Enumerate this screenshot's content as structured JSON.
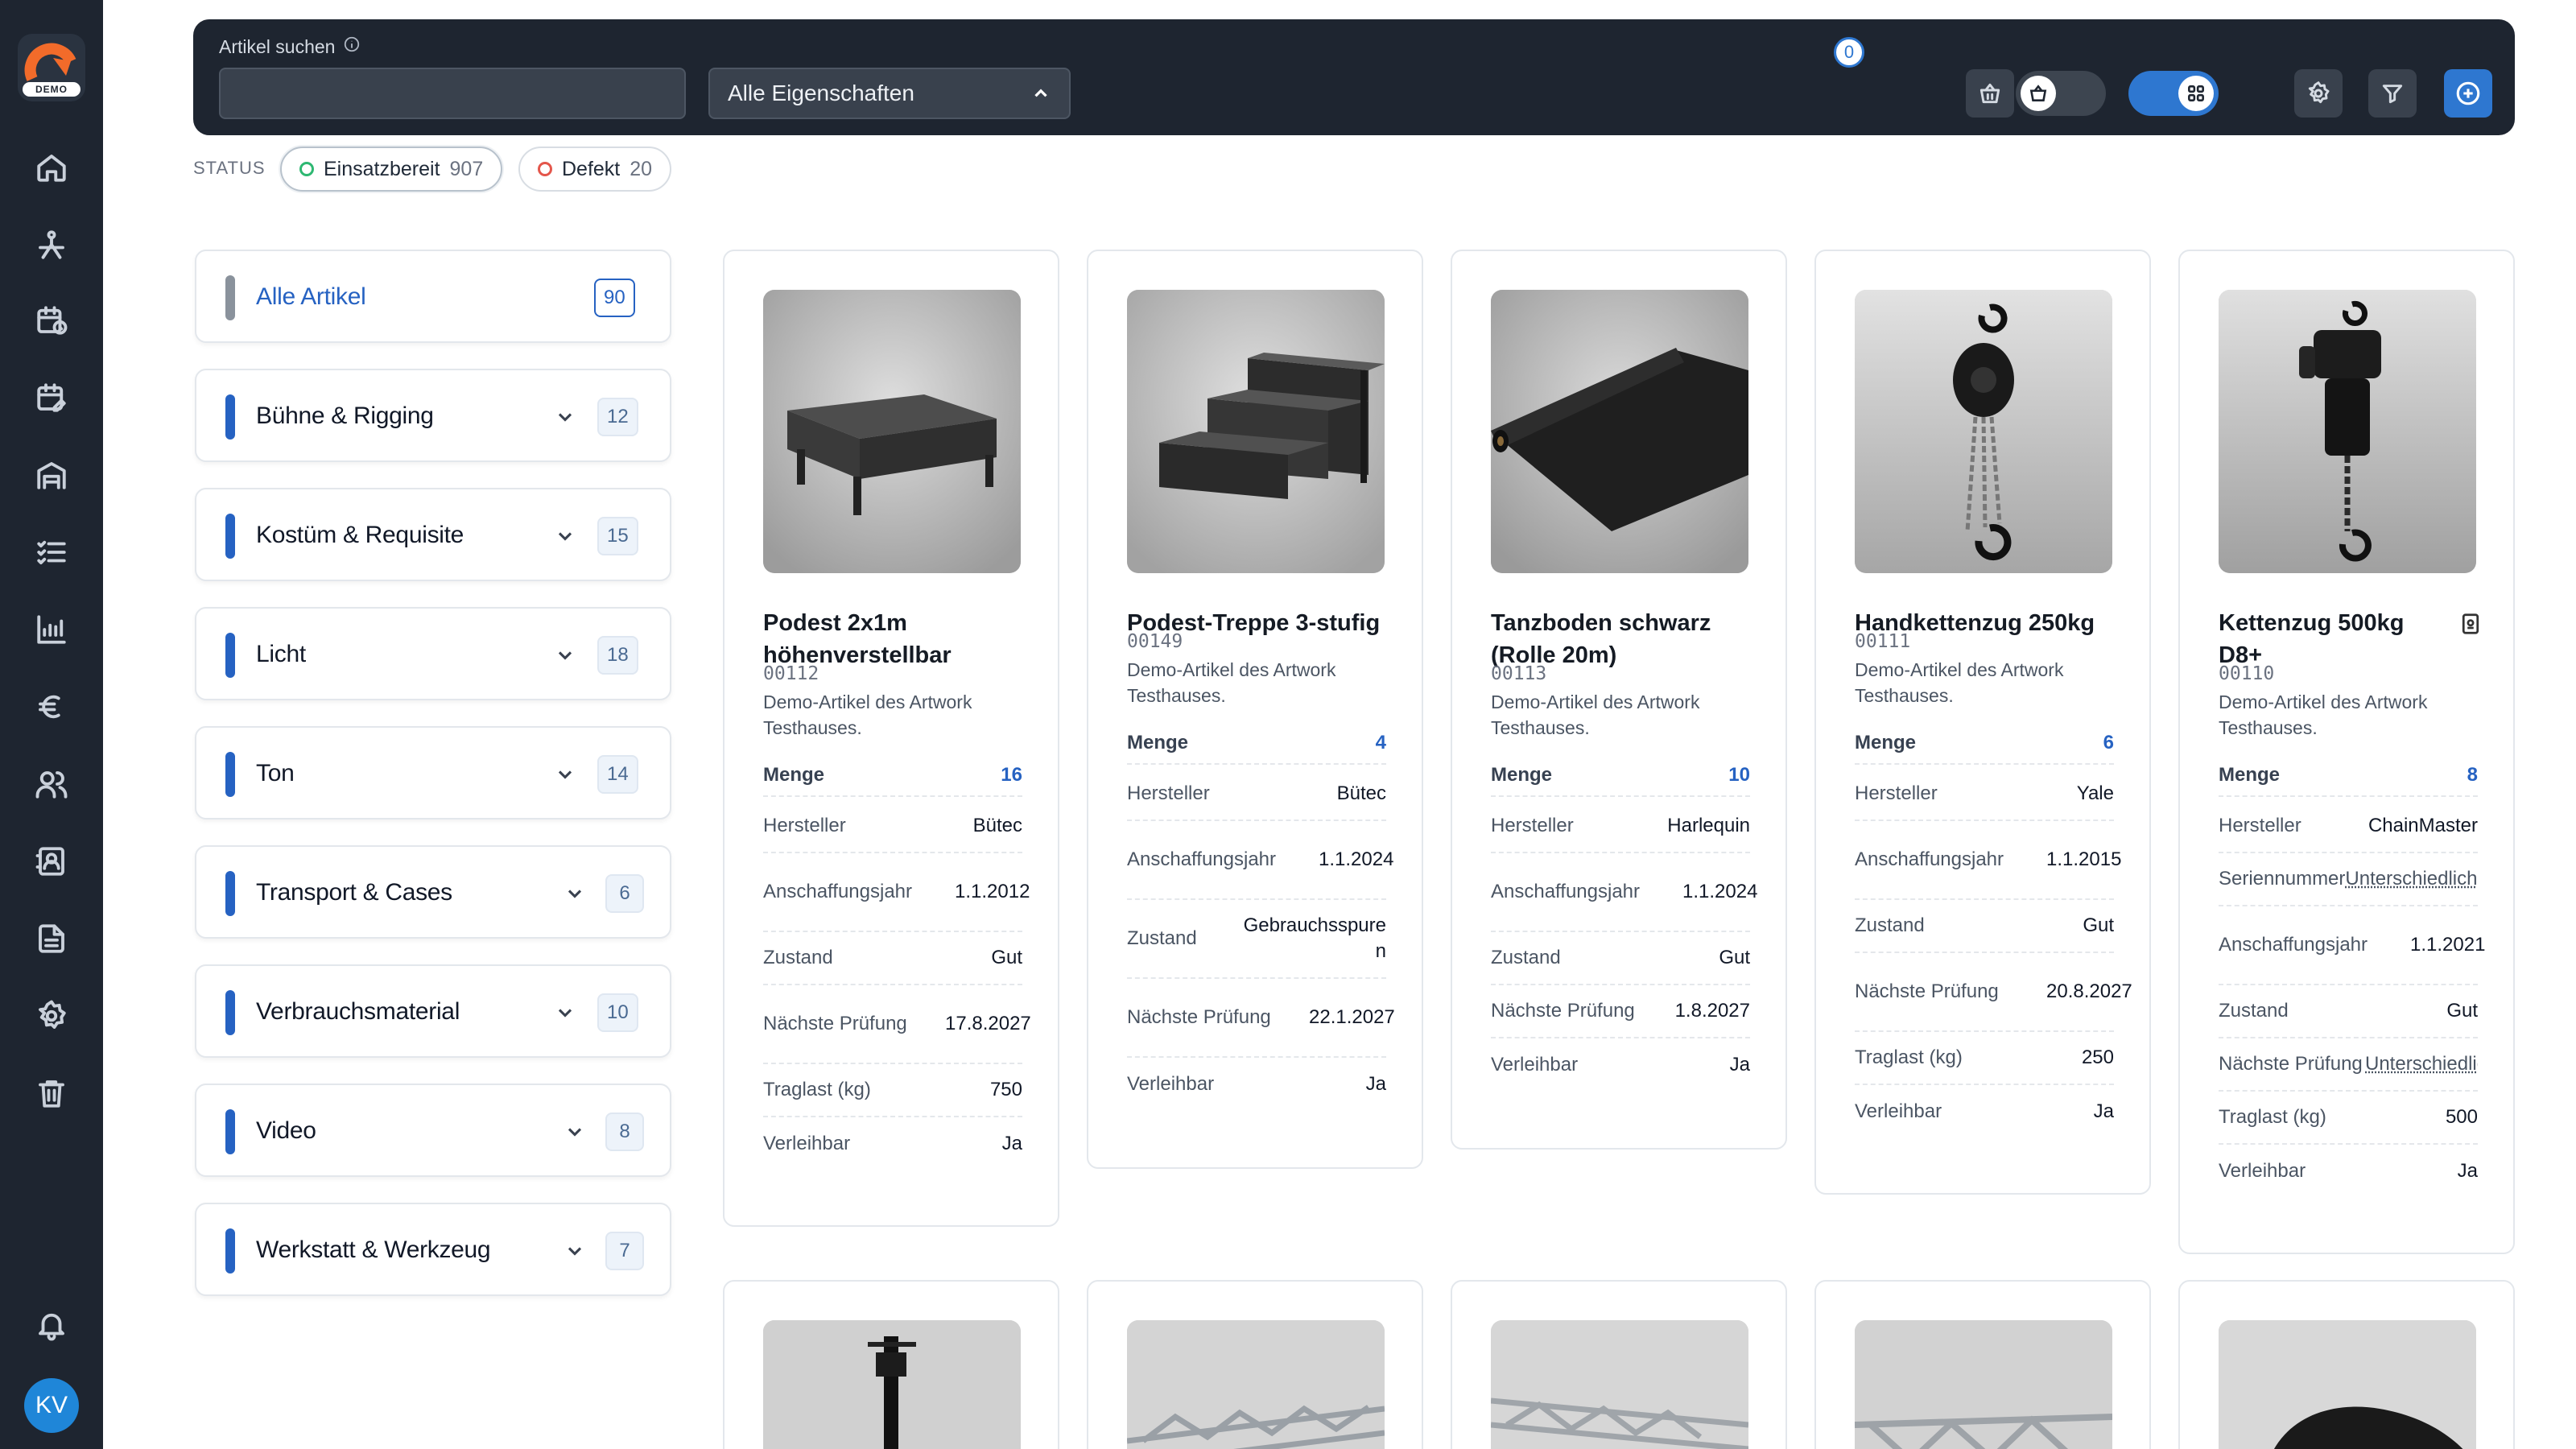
{
  "nav": {
    "logo_badge": "DEMO",
    "avatar_initials": "KV",
    "items": [
      "home-icon",
      "stage-icon",
      "calendar-clock-icon",
      "calendar-edit-icon",
      "warehouse-icon",
      "checklist-icon",
      "chart-icon",
      "euro-icon",
      "users-icon",
      "contacts-icon",
      "document-icon",
      "settings-icon",
      "trash-icon",
      "bell-icon"
    ]
  },
  "topbar": {
    "search_label": "Artikel suchen",
    "search_value": "",
    "search_placeholder": "",
    "properties_select": "Alle Eigenschaften",
    "cart_count": "0",
    "accent_color": "#2e77d0"
  },
  "status": {
    "label": "STATUS",
    "pills": [
      {
        "label": "Einsatzbereit",
        "count": "907",
        "color": "#2eb872"
      },
      {
        "label": "Defekt",
        "count": "20",
        "color": "#e4564b"
      }
    ]
  },
  "categories": [
    {
      "name": "Alle Artikel",
      "count": "90"
    },
    {
      "name": "Bühne & Rigging",
      "count": "12"
    },
    {
      "name": "Kostüm & Requisite",
      "count": "15"
    },
    {
      "name": "Licht",
      "count": "18"
    },
    {
      "name": "Ton",
      "count": "14"
    },
    {
      "name": "Transport & Cases",
      "count": "6"
    },
    {
      "name": "Verbrauchsmaterial",
      "count": "10"
    },
    {
      "name": "Video",
      "count": "8"
    },
    {
      "name": "Werkstatt & Werkzeug",
      "count": "7"
    }
  ],
  "products": [
    {
      "title": "Podest 2x1m höhenverstellbar",
      "code": "00112",
      "desc": "Demo-Artikel des Artwork Testhauses.",
      "menge_label": "Menge",
      "menge": "16",
      "fields": [
        {
          "k": "Hersteller",
          "v": "Bütec"
        },
        {
          "k": "Anschaffungsjahr",
          "v": "1.1.2012"
        },
        {
          "k": "Zustand",
          "v": "Gut"
        },
        {
          "k": "Nächste Prüfung",
          "v": "17.8.2027"
        },
        {
          "k": "Traglast (kg)",
          "v": "750"
        },
        {
          "k": "Verleihbar",
          "v": "Ja"
        }
      ]
    },
    {
      "title": "Podest-Treppe 3-stufig",
      "code": "00149",
      "desc": "Demo-Artikel des Artwork Testhauses.",
      "menge_label": "Menge",
      "menge": "4",
      "fields": [
        {
          "k": "Hersteller",
          "v": "Bütec"
        },
        {
          "k": "Anschaffungsjahr",
          "v": "1.1.2024"
        },
        {
          "k": "Zustand",
          "v": "Gebrauchsspuren"
        },
        {
          "k": "Nächste Prüfung",
          "v": "22.1.2027"
        },
        {
          "k": "Verleihbar",
          "v": "Ja"
        }
      ]
    },
    {
      "title": "Tanzboden schwarz (Rolle 20m)",
      "code": "00113",
      "desc": "Demo-Artikel des Artwork Testhauses.",
      "menge_label": "Menge",
      "menge": "10",
      "fields": [
        {
          "k": "Hersteller",
          "v": "Harlequin"
        },
        {
          "k": "Anschaffungsjahr",
          "v": "1.1.2024"
        },
        {
          "k": "Zustand",
          "v": "Gut"
        },
        {
          "k": "Nächste Prüfung",
          "v": "1.8.2027"
        },
        {
          "k": "Verleihbar",
          "v": "Ja"
        }
      ]
    },
    {
      "title": "Handkettenzug 250kg",
      "code": "00111",
      "desc": "Demo-Artikel des Artwork Testhauses.",
      "menge_label": "Menge",
      "menge": "6",
      "fields": [
        {
          "k": "Hersteller",
          "v": "Yale"
        },
        {
          "k": "Anschaffungsjahr",
          "v": "1.1.2015"
        },
        {
          "k": "Zustand",
          "v": "Gut"
        },
        {
          "k": "Nächste Prüfung",
          "v": "20.8.2027"
        },
        {
          "k": "Traglast (kg)",
          "v": "250"
        },
        {
          "k": "Verleihbar",
          "v": "Ja"
        }
      ]
    },
    {
      "title": "Kettenzug 500kg D8+",
      "code": "00110",
      "desc": "Demo-Artikel des Artwork Testhauses.",
      "menge_label": "Menge",
      "menge": "8",
      "fields": [
        {
          "k": "Hersteller",
          "v": "ChainMaster"
        },
        {
          "k": "Seriennummer",
          "v": "Unterschiedlich"
        },
        {
          "k": "Anschaffungsjahr",
          "v": "1.1.2021"
        },
        {
          "k": "Zustand",
          "v": "Gut"
        },
        {
          "k": "Nächste Prüfung",
          "v": "Unterschiedlich"
        },
        {
          "k": "Traglast (kg)",
          "v": "500"
        },
        {
          "k": "Verleihbar",
          "v": "Ja"
        }
      ]
    }
  ]
}
